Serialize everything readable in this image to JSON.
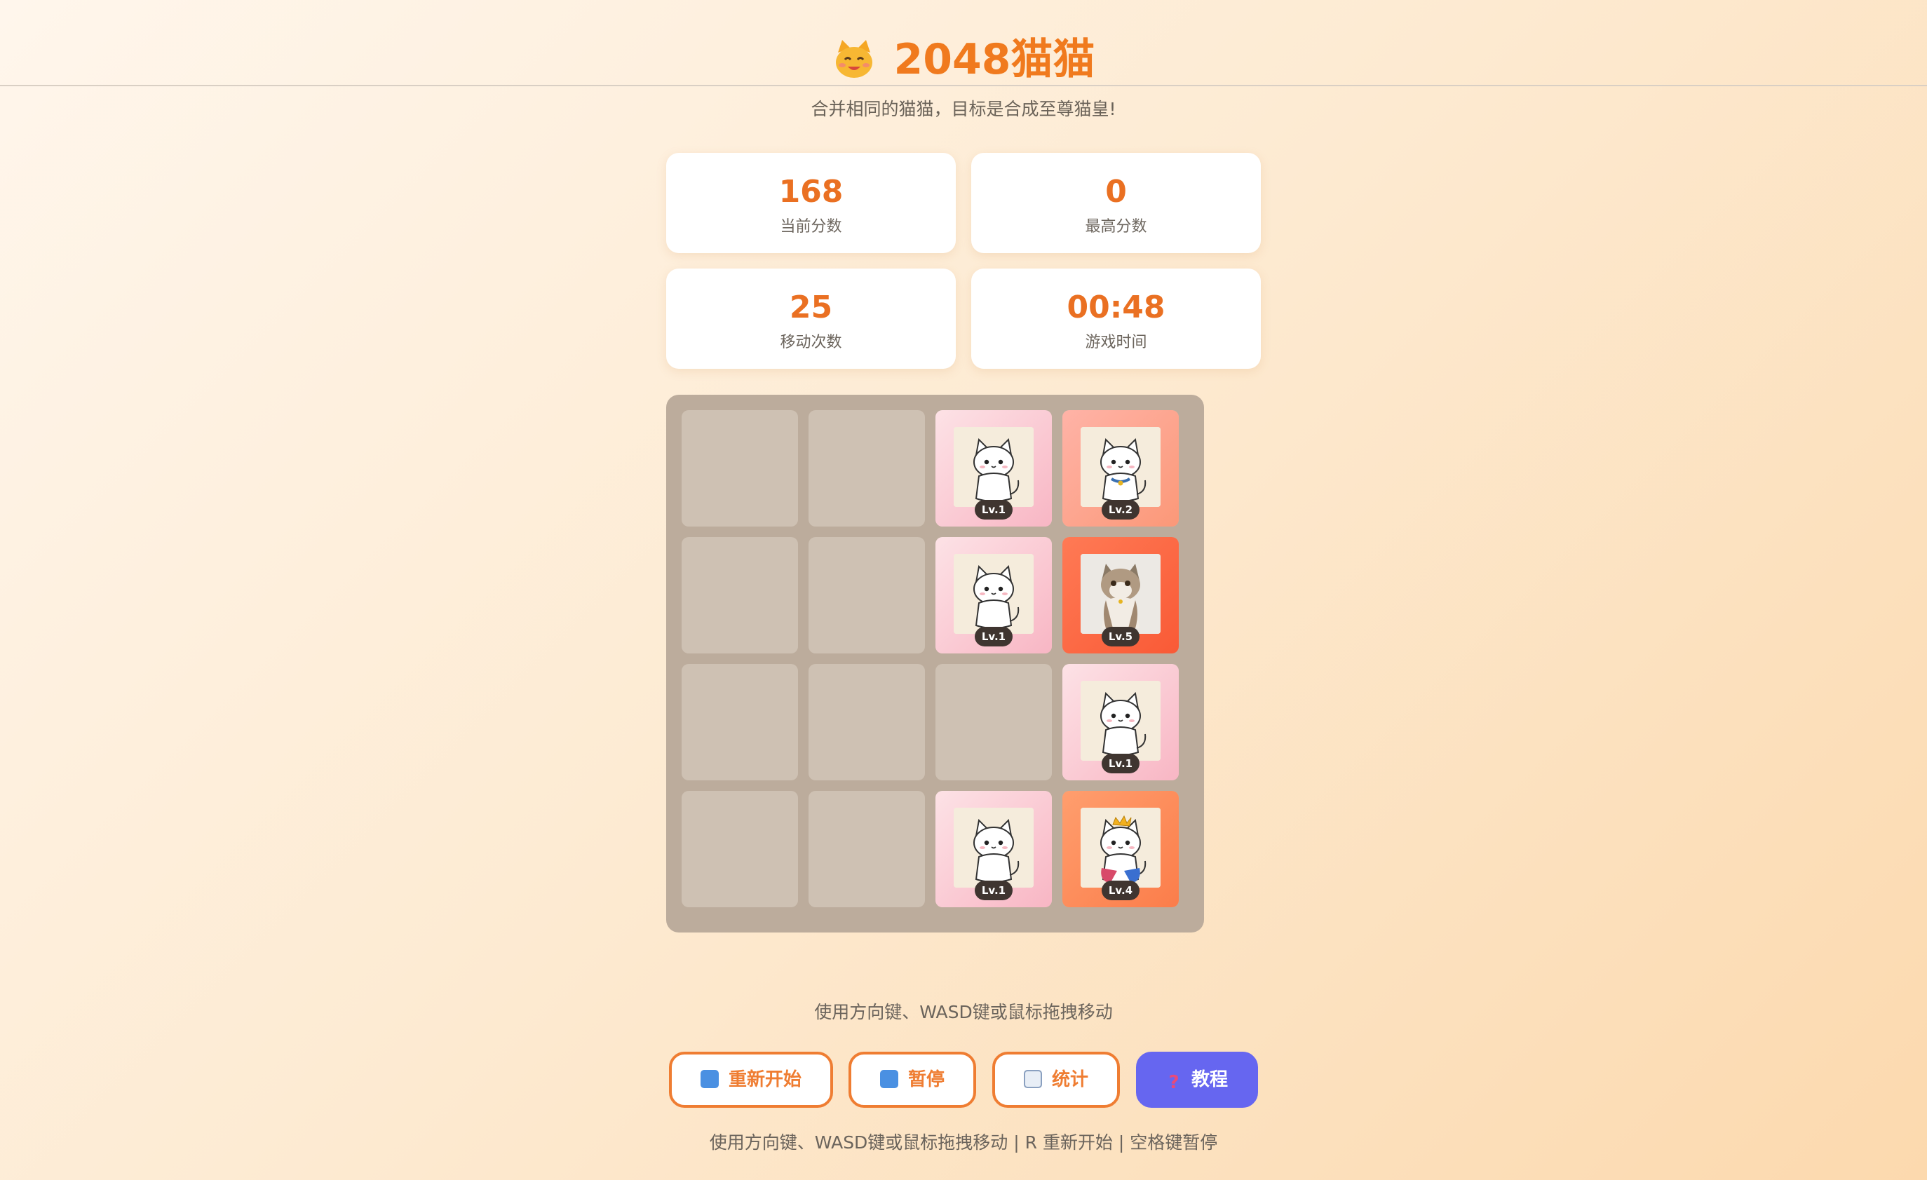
{
  "header": {
    "title": "2048猫猫",
    "title_icon": "cat-face-icon",
    "subtitle": "合并相同的猫猫，目标是合成至尊猫皇!"
  },
  "stats": {
    "score": {
      "value": "168",
      "label": "当前分数"
    },
    "best": {
      "value": "0",
      "label": "最高分数"
    },
    "moves": {
      "value": "25",
      "label": "移动次数"
    },
    "time": {
      "value": "00:48",
      "label": "游戏时间"
    }
  },
  "board": {
    "size": 4,
    "rows": [
      [
        null,
        null,
        "Lv.1",
        "Lv.2"
      ],
      [
        null,
        null,
        "Lv.1",
        "Lv.5"
      ],
      [
        null,
        null,
        null,
        "Lv.1"
      ],
      [
        null,
        null,
        "Lv.1",
        "Lv.4"
      ]
    ]
  },
  "hint": "使用方向键、WASD键或鼠标拖拽移动",
  "buttons": {
    "restart": {
      "label": "重新开始",
      "icon": "refresh-icon"
    },
    "pause": {
      "label": "暂停",
      "icon": "pause-icon"
    },
    "stats": {
      "label": "统计",
      "icon": "bar-chart-icon"
    },
    "tutorial": {
      "label": "教程",
      "icon": "question-icon"
    }
  },
  "footer": "使用方向键、WASD键或鼠标拖拽移动 | R 重新开始 | 空格键暂停",
  "colors": {
    "accent": "#f07a1e",
    "board": "#bcac9c",
    "empty_cell": "#cec1b3",
    "primary_button": "#6666f0"
  }
}
